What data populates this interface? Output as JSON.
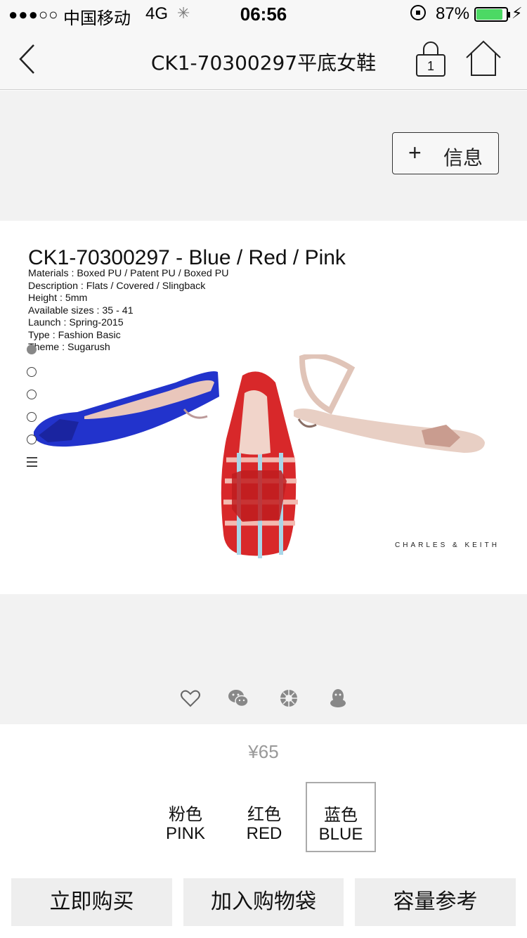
{
  "status_bar": {
    "signal": "●●●○○",
    "carrier": "中国移动",
    "network": "4G",
    "time": "06:56",
    "battery_pct": "87%",
    "battery_level": 0.87
  },
  "nav": {
    "title": "CK1-70300297平底女鞋",
    "bag_count": "1"
  },
  "info_button": {
    "plus": "+",
    "label": "信息"
  },
  "product": {
    "title": "CK1-70300297 - Blue / Red / Pink",
    "specs": [
      "Materials : Boxed PU / Patent PU / Boxed PU",
      "Description : Flats / Covered / Slingback",
      "Height : 5mm",
      "Available sizes : 35 - 41",
      "Launch : Spring-2015",
      "Type : Fashion Basic",
      "Theme : Sugarush"
    ],
    "brand": "CHARLES & KEITH",
    "carousel": {
      "count": 5,
      "active_index": 0
    }
  },
  "share_icons": [
    "heart-icon",
    "wechat-icon",
    "moments-icon",
    "qq-icon"
  ],
  "price": "¥65",
  "colors": [
    {
      "cn": "粉色",
      "en": "PINK",
      "selected": false
    },
    {
      "cn": "红色",
      "en": "RED",
      "selected": false
    },
    {
      "cn": "蓝色",
      "en": "BLUE",
      "selected": true
    }
  ],
  "actions": {
    "buy_now": "立即购买",
    "add_to_bag": "加入购物袋",
    "size_guide": "容量参考"
  },
  "colors_theme": {
    "shoe_blue": "#2233cc",
    "shoe_red": "#d8282a",
    "shoe_pink": "#e8cfc4",
    "battery_green": "#4cd964"
  }
}
